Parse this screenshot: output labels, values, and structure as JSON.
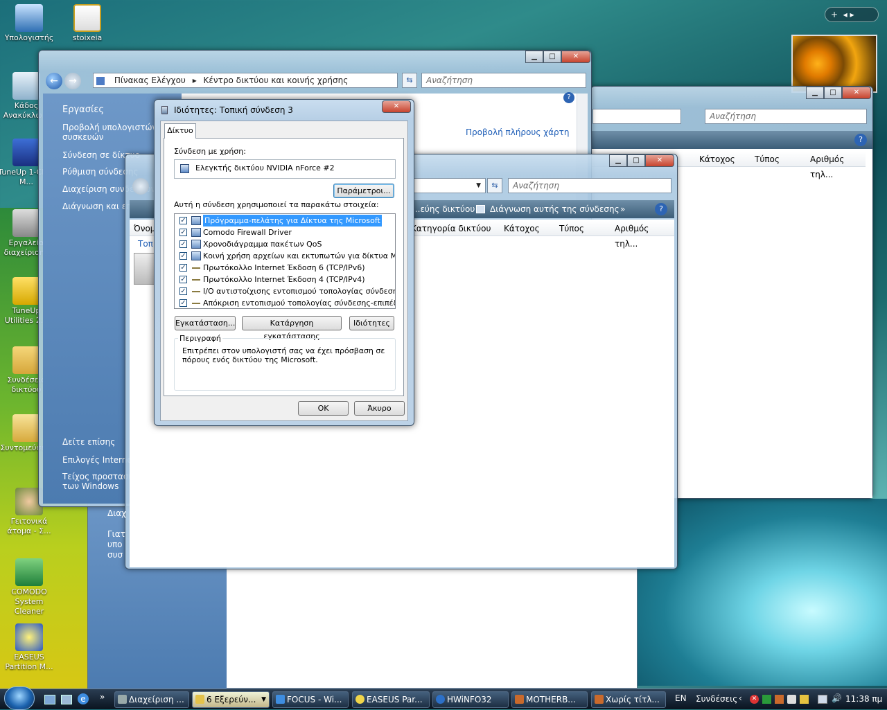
{
  "desktop": {
    "icons": [
      {
        "label": "Υπολογιστής"
      },
      {
        "label": "stoixeia"
      },
      {
        "label": "Κάδο­ς Ανακύκλω..."
      },
      {
        "label": "TuneUp 1-Click M..."
      },
      {
        "label": "Εργαλεία διαχείρισης"
      },
      {
        "label": "TuneUp Utilities 2..."
      },
      {
        "label": "Συνδέσεις δικτύου"
      },
      {
        "label": "Συντομεύσεις"
      },
      {
        "label": "Γειτονικά άτομα - Σ..."
      },
      {
        "label": "COMODO System Cleaner"
      },
      {
        "label": "EASEUS Partition M..."
      }
    ]
  },
  "window_back": {
    "breadcrumb": [
      "Πίνακας Ελέγχου",
      "Κέντρο δικτύου και κοινής χρήσης"
    ],
    "search_placeholder": "Αναζήτηση",
    "tasks_title": "Εργασίες",
    "tasks": [
      "Προβολή υπολογιστών και συσκευών",
      "Σύνδεση σε δίκτυο",
      "Ρύθμιση σύνδεσης",
      "Διαχείριση συνδέσεων",
      "Διάγνωση και επιδιόρθωση"
    ],
    "see_also_title": "Δείτε επίσης",
    "see_also": [
      "Επιλογές Internet",
      "Τείχος προστασίας των Windows"
    ],
    "full_map_link": "Προβολή πλήρους χάρτη"
  },
  "window_right": {
    "search_placeholder": "Αναζήτηση",
    "columns": [
      "Κάτοχος",
      "Τύπος",
      "Αριθμός τηλ..."
    ]
  },
  "window_mid": {
    "search_placeholder": "Αναζήτηση",
    "toolbar": [
      "...εύης δικτύου",
      "Διάγνωση αυτής της σύνδεσης",
      "»"
    ],
    "columns": [
      "Όνομ",
      "Κατηγορία δικτύου",
      "Κάτοχος",
      "Τύπος",
      "Αριθμός τηλ..."
    ],
    "side_text": [
      "Τοπ",
      "Διαχ",
      "Γιατ",
      "υπο",
      "συσ"
    ]
  },
  "dialog": {
    "title": "Ιδιότητες: Τοπική σύνδεση 3",
    "tab": "Δίκτυο",
    "connect_using_label": "Σύνδεση με χρήση:",
    "adapter": "Ελεγκτής δικτύου NVIDIA nForce #2",
    "configure_button": "Παράμετροι...",
    "items_label": "Αυτή η σύνδεση χρησιμοποιεί τα παρακάτω στοιχεία:",
    "items": [
      {
        "label": "Πρόγραμμα-πελάτης για Δίκτυα της Microsoft",
        "checked": true,
        "icon": "client-icon",
        "selected": true
      },
      {
        "label": "Comodo Firewall Driver",
        "checked": true,
        "icon": "service-icon",
        "selected": false
      },
      {
        "label": "Χρονοδιάγραμμα πακέτων QoS",
        "checked": true,
        "icon": "service-icon",
        "selected": false
      },
      {
        "label": "Κοινή χρήση αρχείων και εκτυπωτών για δίκτυα Micr...",
        "checked": true,
        "icon": "service-icon",
        "selected": false
      },
      {
        "label": "Πρωτόκολλο Internet Έκδοση 6 (TCP/IPv6)",
        "checked": true,
        "icon": "protocol-icon",
        "selected": false
      },
      {
        "label": "Πρωτόκολλο Internet Έκδοση 4 (TCP/IPv4)",
        "checked": true,
        "icon": "protocol-icon",
        "selected": false
      },
      {
        "label": "I/O αντιστοίχισης εντοπισμού τοπολογίας σύνδεσης...",
        "checked": true,
        "icon": "protocol-icon",
        "selected": false
      },
      {
        "label": "Απόκριση εντοπισμού τοπολογίας σύνδεσης-επιπέδου",
        "checked": true,
        "icon": "protocol-icon",
        "selected": false
      }
    ],
    "install_button": "Εγκατάσταση...",
    "uninstall_button": "Κατάργηση εγκατάστασης",
    "properties_button": "Ιδιότητες",
    "description_title": "Περιγραφή",
    "description": "Επιτρέπει στον υπολογιστή σας να έχει πρόσβαση σε πόρους ενός δικτύου της Microsoft.",
    "ok_button": "OK",
    "cancel_button": "Άκυρο"
  },
  "taskbar": {
    "buttons": [
      {
        "label": "Διαχείριση ..."
      },
      {
        "label": "6 Εξερεύν..."
      },
      {
        "label": "FOCUS - Wi..."
      },
      {
        "label": "EASEUS Par..."
      },
      {
        "label": "HWiNFO32"
      },
      {
        "label": "MOTHERB..."
      },
      {
        "label": "Χωρίς τίτλ..."
      }
    ],
    "language": "EN",
    "connections": "Συνδέσεις",
    "clock": "11:38 πμ"
  }
}
